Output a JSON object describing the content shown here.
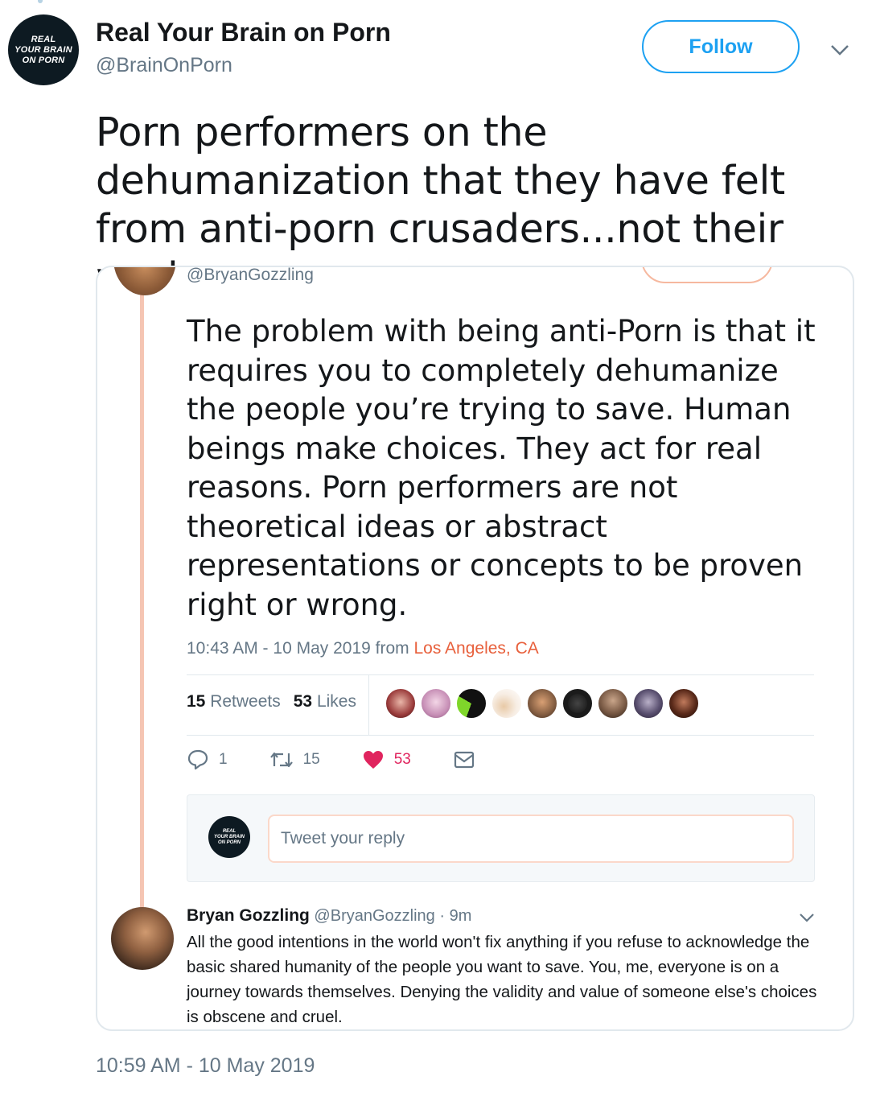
{
  "author": {
    "display_name": "Real Your Brain on Porn",
    "handle": "@BrainOnPorn",
    "avatar_text": [
      "REAL",
      "YOUR BRAIN",
      "ON PORN"
    ]
  },
  "follow_label": "Follow",
  "tweet_text": "Porn performers on the dehumanization that they have felt from anti-porn crusaders...not their work.",
  "quoted": {
    "handle": "@BryanGozzling",
    "text": "The problem with being anti-Porn is that it requires you to completely dehumanize the people you’re trying to save. Human beings make choices. They act for real reasons. Porn performers are not theoretical ideas or abstract representations or concepts to be proven right or wrong.",
    "meta_time": "10:43 AM - 10 May 2019 from ",
    "location": "Los Angeles, CA",
    "retweets_count": "15",
    "retweets_label": "Retweets",
    "likes_count": "53",
    "likes_label": "Likes",
    "actions": {
      "reply_count": "1",
      "retweet_count": "15",
      "like_count": "53"
    },
    "reply_placeholder": "Tweet your reply",
    "reply": {
      "name": "Bryan Gozzling",
      "handle": "@BryanGozzling",
      "time": "· 9m",
      "text": "All the good intentions in the world won't fix anything if you refuse to acknowledge the basic shared humanity of the people you want to save. You, me, everyone is on a journey towards themselves. Denying the validity and value of someone else's choices is obscene and cruel."
    }
  },
  "timestamp": "10:59 AM - 10 May 2019",
  "colors": {
    "accent_blue": "#1da1f2",
    "accent_orange": "#e8603c",
    "like_red": "#e0245e"
  }
}
